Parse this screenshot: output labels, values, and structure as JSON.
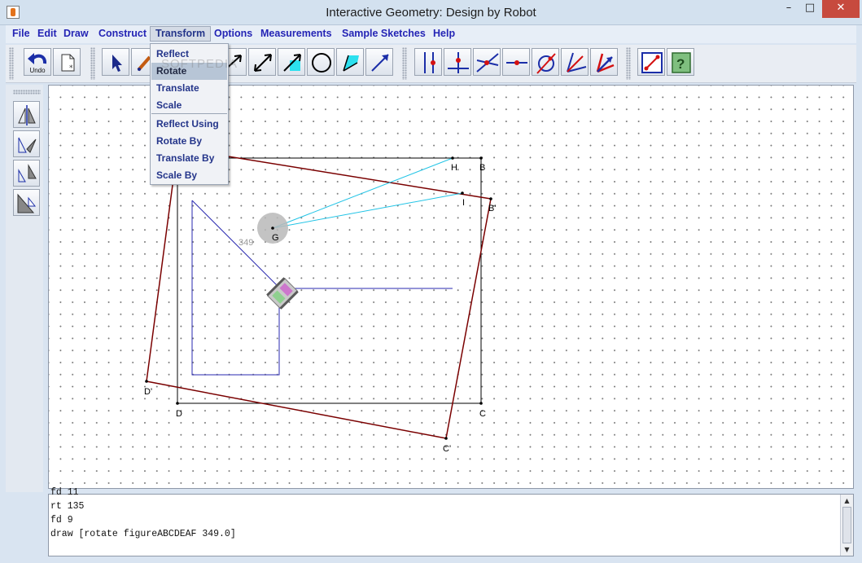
{
  "window": {
    "title": "Interactive Geometry: Design by Robot",
    "minimize": "–",
    "maximize": "□",
    "close": "✕"
  },
  "menubar": [
    {
      "label": "File"
    },
    {
      "label": "Edit"
    },
    {
      "label": "Draw"
    },
    {
      "label": "Construct"
    },
    {
      "label": "Transform",
      "open": true
    },
    {
      "label": "Options"
    },
    {
      "label": "Measurements"
    },
    {
      "label": "Sample Sketches"
    },
    {
      "label": "Help"
    }
  ],
  "transform_menu": {
    "items": [
      {
        "label": "Reflect"
      },
      {
        "label": "Rotate",
        "highlighted": true
      },
      {
        "label": "Translate"
      },
      {
        "label": "Scale"
      },
      {
        "label": "Reflect Using"
      },
      {
        "label": "Rotate By"
      },
      {
        "label": "Translate By"
      },
      {
        "label": "Scale By"
      }
    ]
  },
  "toolbar": {
    "undo_label": "Undo",
    "icons": [
      "undo-icon",
      "new-sketch-icon",
      "select-arrow-icon",
      "draw-pencil-icon",
      "segment-icon",
      "ray-icon",
      "segment-ray-icon",
      "circle-icon",
      "polygon-icon",
      "vector-icon",
      "parallel-icon",
      "perpendicular-icon",
      "intersection-icon",
      "midpoint-icon",
      "circle-point-icon",
      "angle-bisector-icon",
      "angle-icon",
      "coordinate-icon",
      "help-icon"
    ]
  },
  "sidebar": {
    "icons": [
      "reflect-tool-icon",
      "rotate-tool-icon",
      "translate-tool-icon",
      "scale-tool-icon"
    ]
  },
  "canvas": {
    "points": {
      "B": "B",
      "B_prime": "B'",
      "C": "C",
      "C_prime": "C'",
      "D": "D",
      "D_prime": "D'",
      "G": "G",
      "H": "H",
      "I": "I"
    },
    "angle_value": "349",
    "colors": {
      "rectangle": "#000000",
      "rotated_rectangle": "#7a0000",
      "figure": "#2a2ab0",
      "rays": "#22c4e6",
      "center_marker": "#b9b9b9"
    }
  },
  "console": {
    "lines": [
      "fd 11",
      "rt 135",
      "fd 9",
      "draw [rotate figureABCDEAF 349.0]"
    ]
  },
  "watermark": "SOFTPEDIA"
}
